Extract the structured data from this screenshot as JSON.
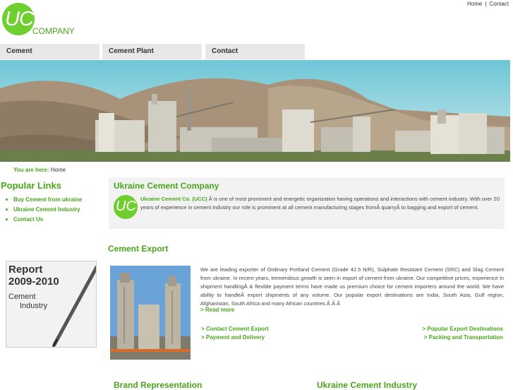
{
  "toplinks": {
    "home": "Home",
    "sep": "|",
    "contact": "Contact"
  },
  "logo": {
    "mark": "UC",
    "word": "COMPANY"
  },
  "nav": {
    "items": [
      "Cement",
      "Cement Plant",
      "Contact"
    ]
  },
  "breadcrumb": {
    "prefix": "You are here:",
    "current": "Home"
  },
  "sidebar": {
    "title": "Popular Links",
    "links": [
      "Buy Cement from ukraine",
      "Ukraine Cement Industry",
      "Contact Us"
    ],
    "report": {
      "title_line1": "Report",
      "title_line2": "2009-2010",
      "sub_line1": "Cement",
      "sub_line2": "Industry"
    }
  },
  "intro": {
    "title": "Ukraine Cement Company",
    "logo_mark": "UC",
    "company": "Ukraine Cement Co. (UCC)",
    "text": "Â is one of most prominent and energetic organization having operations and interactions with cement industry. With over 20 years of experience in cement industry our role is prominent at all cement manufacturing stages fromÂ quarryÂ to bagging and export of cement."
  },
  "export": {
    "title": "Cement Export",
    "text": "We are leading exporter of Ordinary Portland Cement (Grade 42.5 N/R), Sulphate Resistant Cement (SRC) and Slag Cement from ukraine. In recent years, tremendous growth is seen in export of cement from ukraine. Our competitive prices, experience in shipment handlingÂ & flexible payment terms have made us premium choice for cement importers around the world. We have ability to handleÂ export shipments of any volume. Our popular export destinations are India, South Asia, Gulf region, Afghanistan, South Africa and many African countries.Â Â Â",
    "read_more": "> Read more",
    "links": {
      "contact_export": "> Contact Cement Export",
      "payment": "> Payment and Delivery",
      "destinations": "> Popular Export Destinations",
      "packing": "> Packing and Transportation"
    }
  },
  "bottom": {
    "left_title": "Brand Representation",
    "right_title": "Ukraine Cement Industry"
  }
}
